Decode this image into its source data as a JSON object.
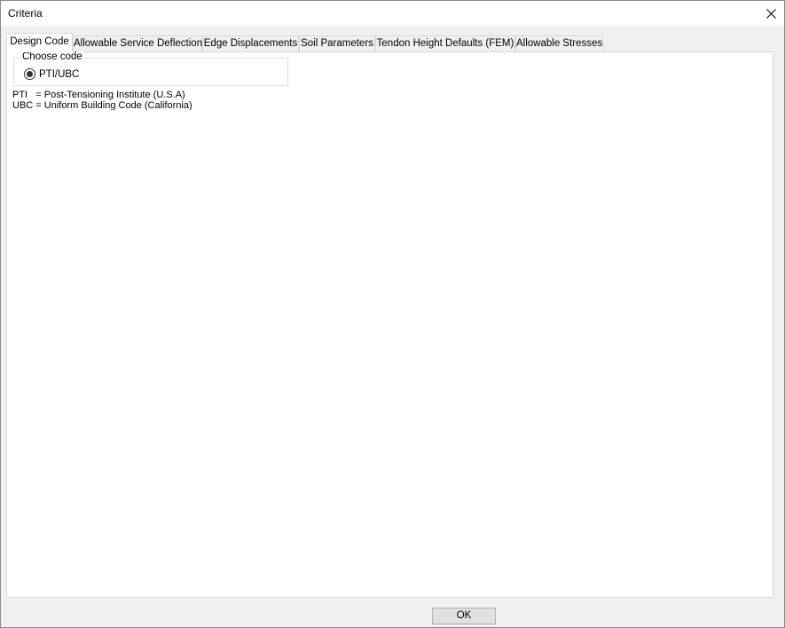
{
  "window": {
    "title": "Criteria"
  },
  "tabs": [
    {
      "label": "Design Code"
    },
    {
      "label": "Allowable Service Deflection"
    },
    {
      "label": "Edge Displacements"
    },
    {
      "label": "Soil Parameters"
    },
    {
      "label": "Tendon Height  Defaults (FEM)"
    },
    {
      "label": "Allowable Stresses"
    }
  ],
  "design_code": {
    "group_label": "Choose code",
    "option_label": "PTI/UBC",
    "notes": [
      "PTI   = Post-Tensioning Institute (U.S.A)",
      "UBC = Uniform Building Code (California)"
    ]
  },
  "footer": {
    "ok_label": "OK"
  }
}
